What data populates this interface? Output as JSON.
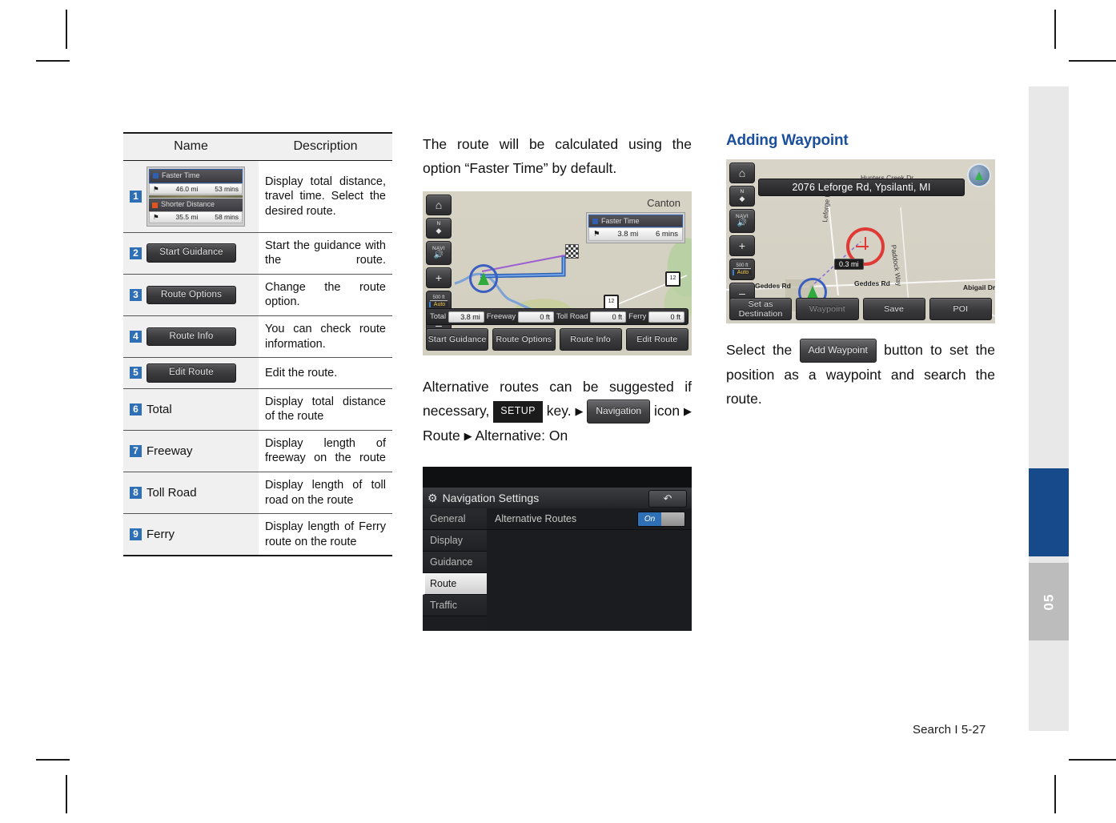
{
  "page": {
    "footer": "Search I 5-27",
    "tab_number": "05",
    "accent_blue": "#174a8b",
    "heading_blue": "#1b4f9c",
    "number_badge_blue": "#2f6fb5"
  },
  "table": {
    "headers": {
      "name": "Name",
      "description": "Description"
    },
    "rows": [
      {
        "num": "1",
        "name_type": "route-card",
        "description": "Display total distance, travel time. Select the desired route."
      },
      {
        "num": "2",
        "name_type": "button",
        "label": "Start Guidance",
        "description": "Start the guidance with the route."
      },
      {
        "num": "3",
        "name_type": "button",
        "label": "Route Options",
        "description": "Change the route option."
      },
      {
        "num": "4",
        "name_type": "button",
        "label": "Route Info",
        "description": "You can check route information."
      },
      {
        "num": "5",
        "name_type": "button",
        "label": "Edit Route",
        "description": "Edit the route."
      },
      {
        "num": "6",
        "name_type": "text",
        "label": "Total",
        "description": "Display total distance of the route"
      },
      {
        "num": "7",
        "name_type": "text",
        "label": "Freeway",
        "description": "Display length of freeway on the route"
      },
      {
        "num": "8",
        "name_type": "text",
        "label": "Toll Road",
        "description": "Display length of toll road on the route"
      },
      {
        "num": "9",
        "name_type": "text",
        "label": "Ferry",
        "description": "Display length of Ferry route on the route"
      }
    ],
    "route_card": {
      "faster": {
        "label": "Faster Time",
        "distance": "46.0 mi",
        "time": "53 mins",
        "swatch": "#2f5fae"
      },
      "shorter": {
        "label": "Shorter Distance",
        "distance": "35.5 mi",
        "time": "58 mins",
        "swatch": "#e2541f"
      }
    }
  },
  "middle": {
    "paragraph1": "The route will be calculated using the option “Faster Time” by default.",
    "paragraph2_pre": "Alternative routes can be suggested if necessary,",
    "setup_key": "SETUP",
    "key_word": "key.",
    "navigation_chip": "Navigation",
    "icon_word": "icon",
    "path_route": "Route",
    "path_alternative": "Alternative: On",
    "arrow": "▶",
    "map_screenshot": {
      "city_label": "Canton",
      "left_buttons": [
        {
          "icon": "home-icon",
          "label": ""
        },
        {
          "icon": "north-up-icon",
          "label": "N"
        },
        {
          "icon": "navi-volume-icon",
          "label": "NAVI"
        },
        {
          "icon": "zoom-in-icon",
          "label": "+"
        },
        {
          "icon": "scale-auto-icon",
          "label": "Auto",
          "scale": "500 ft"
        },
        {
          "icon": "zoom-out-icon",
          "label": "–"
        }
      ],
      "route_card": {
        "label": "Faster Time",
        "distance": "3.8 mi",
        "time": "6 mins",
        "swatch": "#2f5fae"
      },
      "info_strip": [
        {
          "label": "Total",
          "value": "3.8 mi"
        },
        {
          "label": "Freeway",
          "value": "0 ft"
        },
        {
          "label": "Toll Road",
          "value": "0 ft"
        },
        {
          "label": "Ferry",
          "value": "0 ft"
        }
      ],
      "buttons": [
        "Start Guidance",
        "Route Options",
        "Route Info",
        "Edit Route"
      ]
    },
    "settings_screenshot": {
      "title": "Navigation Settings",
      "gear_icon": "gear-icon",
      "back_icon": "↶",
      "nav_items": [
        "General",
        "Display",
        "Guidance",
        "Route",
        "Traffic"
      ],
      "active_nav": "Route",
      "setting_row": {
        "label": "Alternative Routes",
        "toggle_state": "On"
      }
    }
  },
  "right": {
    "heading": "Adding Waypoint",
    "paragraph_pre": "Select the",
    "add_waypoint_chip": "Add Waypoint",
    "paragraph_post": "button to set the position as a waypoint and search the route.",
    "map_screenshot": {
      "address": "2076 Leforge Rd, Ypsilanti, MI",
      "left_buttons": [
        {
          "icon": "home-icon",
          "label": ""
        },
        {
          "icon": "north-up-icon",
          "label": "N"
        },
        {
          "icon": "navi-volume-icon",
          "label": "NAVI"
        },
        {
          "icon": "zoom-in-icon",
          "label": "+"
        },
        {
          "icon": "scale-auto-icon",
          "label": "Auto",
          "scale": "500 ft"
        },
        {
          "icon": "zoom-out-icon",
          "label": "–"
        }
      ],
      "compass_icon": "compass-icon",
      "road_labels": [
        "Hunters Creek Dr",
        "Leforge Rd",
        "Paddock Way",
        "Geddes Rd",
        "Geddes Rd",
        "Abigail Dr"
      ],
      "distance_chip": "0.3 mi",
      "buttons": [
        "Set as\nDestination",
        "Waypoint",
        "Save",
        "POI"
      ],
      "disabled_button": "Waypoint"
    }
  }
}
